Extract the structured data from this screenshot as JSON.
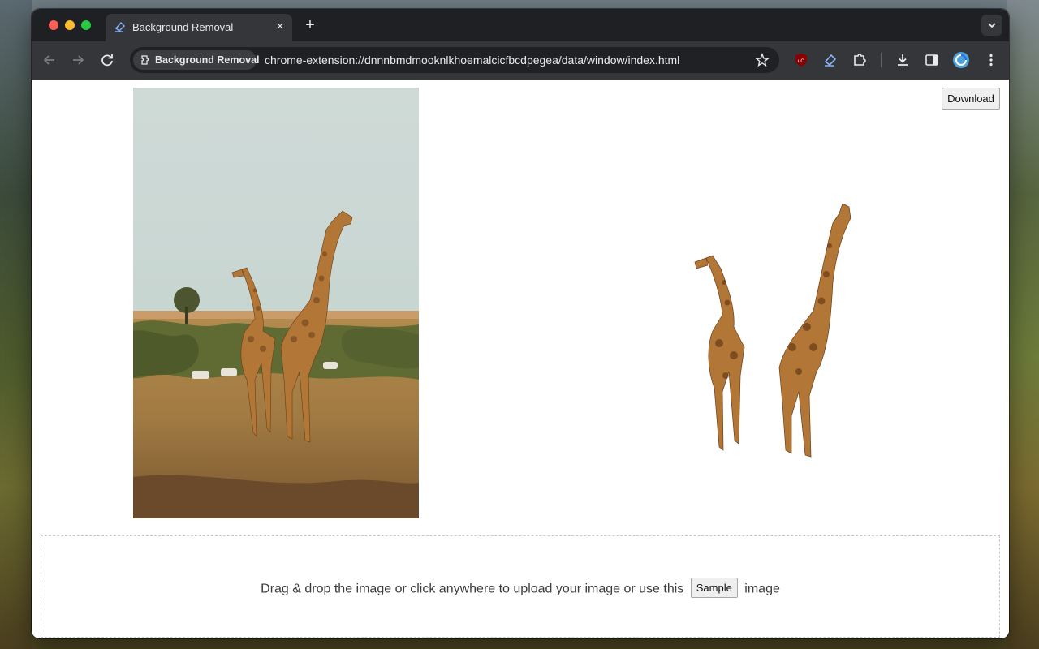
{
  "tab": {
    "title": "Background Removal",
    "close_glyph": "×",
    "new_tab_glyph": "+"
  },
  "omnibox": {
    "site_chip": "Background Removal",
    "url": "chrome-extension://dnnnbmdmooknlkhoemalcicfbcdpegea/data/window/index.html"
  },
  "toolbar_icons": [
    "back-icon",
    "forward-icon",
    "reload-icon",
    "bookmark-star-icon",
    "ublock-icon",
    "eraser-extension-icon",
    "extensions-puzzle-icon",
    "downloads-icon",
    "side-panel-icon",
    "profile-avatar-icon",
    "menu-kebab-icon"
  ],
  "page": {
    "download_label": "Download",
    "drop_text_before": "Drag & drop the image or click anywhere to upload your image or use this",
    "sample_label": "Sample",
    "drop_text_after": "image"
  },
  "colors": {
    "chrome_dark": "#1f2023",
    "toolbar": "#35363a",
    "omnibox": "#202124",
    "accent_blue": "#8ab4f8"
  }
}
